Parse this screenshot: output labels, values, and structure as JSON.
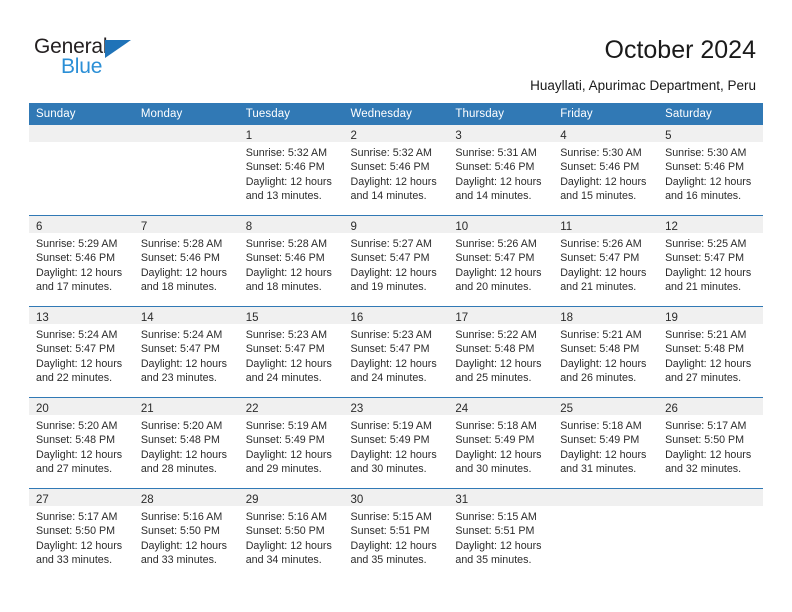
{
  "logo": {
    "word_one": "General",
    "word_two": "Blue",
    "triangle_icon": "triangle-icon",
    "brand_blue": "#2b8fd6",
    "triangle_blue": "#1f73b8"
  },
  "header": {
    "title": "October 2024",
    "subtitle": "Huayllati, Apurimac Department, Peru"
  },
  "calendar": {
    "header_color": "#3179b5",
    "daynum_band_color": "#f0f0f0",
    "weekday_headers": [
      "Sunday",
      "Monday",
      "Tuesday",
      "Wednesday",
      "Thursday",
      "Friday",
      "Saturday"
    ],
    "weeks": [
      [
        {
          "day": "",
          "lines": []
        },
        {
          "day": "",
          "lines": []
        },
        {
          "day": "1",
          "lines": [
            "Sunrise: 5:32 AM",
            "Sunset: 5:46 PM",
            "Daylight: 12 hours",
            "and 13 minutes."
          ]
        },
        {
          "day": "2",
          "lines": [
            "Sunrise: 5:32 AM",
            "Sunset: 5:46 PM",
            "Daylight: 12 hours",
            "and 14 minutes."
          ]
        },
        {
          "day": "3",
          "lines": [
            "Sunrise: 5:31 AM",
            "Sunset: 5:46 PM",
            "Daylight: 12 hours",
            "and 14 minutes."
          ]
        },
        {
          "day": "4",
          "lines": [
            "Sunrise: 5:30 AM",
            "Sunset: 5:46 PM",
            "Daylight: 12 hours",
            "and 15 minutes."
          ]
        },
        {
          "day": "5",
          "lines": [
            "Sunrise: 5:30 AM",
            "Sunset: 5:46 PM",
            "Daylight: 12 hours",
            "and 16 minutes."
          ]
        }
      ],
      [
        {
          "day": "6",
          "lines": [
            "Sunrise: 5:29 AM",
            "Sunset: 5:46 PM",
            "Daylight: 12 hours",
            "and 17 minutes."
          ]
        },
        {
          "day": "7",
          "lines": [
            "Sunrise: 5:28 AM",
            "Sunset: 5:46 PM",
            "Daylight: 12 hours",
            "and 18 minutes."
          ]
        },
        {
          "day": "8",
          "lines": [
            "Sunrise: 5:28 AM",
            "Sunset: 5:46 PM",
            "Daylight: 12 hours",
            "and 18 minutes."
          ]
        },
        {
          "day": "9",
          "lines": [
            "Sunrise: 5:27 AM",
            "Sunset: 5:47 PM",
            "Daylight: 12 hours",
            "and 19 minutes."
          ]
        },
        {
          "day": "10",
          "lines": [
            "Sunrise: 5:26 AM",
            "Sunset: 5:47 PM",
            "Daylight: 12 hours",
            "and 20 minutes."
          ]
        },
        {
          "day": "11",
          "lines": [
            "Sunrise: 5:26 AM",
            "Sunset: 5:47 PM",
            "Daylight: 12 hours",
            "and 21 minutes."
          ]
        },
        {
          "day": "12",
          "lines": [
            "Sunrise: 5:25 AM",
            "Sunset: 5:47 PM",
            "Daylight: 12 hours",
            "and 21 minutes."
          ]
        }
      ],
      [
        {
          "day": "13",
          "lines": [
            "Sunrise: 5:24 AM",
            "Sunset: 5:47 PM",
            "Daylight: 12 hours",
            "and 22 minutes."
          ]
        },
        {
          "day": "14",
          "lines": [
            "Sunrise: 5:24 AM",
            "Sunset: 5:47 PM",
            "Daylight: 12 hours",
            "and 23 minutes."
          ]
        },
        {
          "day": "15",
          "lines": [
            "Sunrise: 5:23 AM",
            "Sunset: 5:47 PM",
            "Daylight: 12 hours",
            "and 24 minutes."
          ]
        },
        {
          "day": "16",
          "lines": [
            "Sunrise: 5:23 AM",
            "Sunset: 5:47 PM",
            "Daylight: 12 hours",
            "and 24 minutes."
          ]
        },
        {
          "day": "17",
          "lines": [
            "Sunrise: 5:22 AM",
            "Sunset: 5:48 PM",
            "Daylight: 12 hours",
            "and 25 minutes."
          ]
        },
        {
          "day": "18",
          "lines": [
            "Sunrise: 5:21 AM",
            "Sunset: 5:48 PM",
            "Daylight: 12 hours",
            "and 26 minutes."
          ]
        },
        {
          "day": "19",
          "lines": [
            "Sunrise: 5:21 AM",
            "Sunset: 5:48 PM",
            "Daylight: 12 hours",
            "and 27 minutes."
          ]
        }
      ],
      [
        {
          "day": "20",
          "lines": [
            "Sunrise: 5:20 AM",
            "Sunset: 5:48 PM",
            "Daylight: 12 hours",
            "and 27 minutes."
          ]
        },
        {
          "day": "21",
          "lines": [
            "Sunrise: 5:20 AM",
            "Sunset: 5:48 PM",
            "Daylight: 12 hours",
            "and 28 minutes."
          ]
        },
        {
          "day": "22",
          "lines": [
            "Sunrise: 5:19 AM",
            "Sunset: 5:49 PM",
            "Daylight: 12 hours",
            "and 29 minutes."
          ]
        },
        {
          "day": "23",
          "lines": [
            "Sunrise: 5:19 AM",
            "Sunset: 5:49 PM",
            "Daylight: 12 hours",
            "and 30 minutes."
          ]
        },
        {
          "day": "24",
          "lines": [
            "Sunrise: 5:18 AM",
            "Sunset: 5:49 PM",
            "Daylight: 12 hours",
            "and 30 minutes."
          ]
        },
        {
          "day": "25",
          "lines": [
            "Sunrise: 5:18 AM",
            "Sunset: 5:49 PM",
            "Daylight: 12 hours",
            "and 31 minutes."
          ]
        },
        {
          "day": "26",
          "lines": [
            "Sunrise: 5:17 AM",
            "Sunset: 5:50 PM",
            "Daylight: 12 hours",
            "and 32 minutes."
          ]
        }
      ],
      [
        {
          "day": "27",
          "lines": [
            "Sunrise: 5:17 AM",
            "Sunset: 5:50 PM",
            "Daylight: 12 hours",
            "and 33 minutes."
          ]
        },
        {
          "day": "28",
          "lines": [
            "Sunrise: 5:16 AM",
            "Sunset: 5:50 PM",
            "Daylight: 12 hours",
            "and 33 minutes."
          ]
        },
        {
          "day": "29",
          "lines": [
            "Sunrise: 5:16 AM",
            "Sunset: 5:50 PM",
            "Daylight: 12 hours",
            "and 34 minutes."
          ]
        },
        {
          "day": "30",
          "lines": [
            "Sunrise: 5:15 AM",
            "Sunset: 5:51 PM",
            "Daylight: 12 hours",
            "and 35 minutes."
          ]
        },
        {
          "day": "31",
          "lines": [
            "Sunrise: 5:15 AM",
            "Sunset: 5:51 PM",
            "Daylight: 12 hours",
            "and 35 minutes."
          ]
        },
        {
          "day": "",
          "lines": []
        },
        {
          "day": "",
          "lines": []
        }
      ]
    ]
  }
}
